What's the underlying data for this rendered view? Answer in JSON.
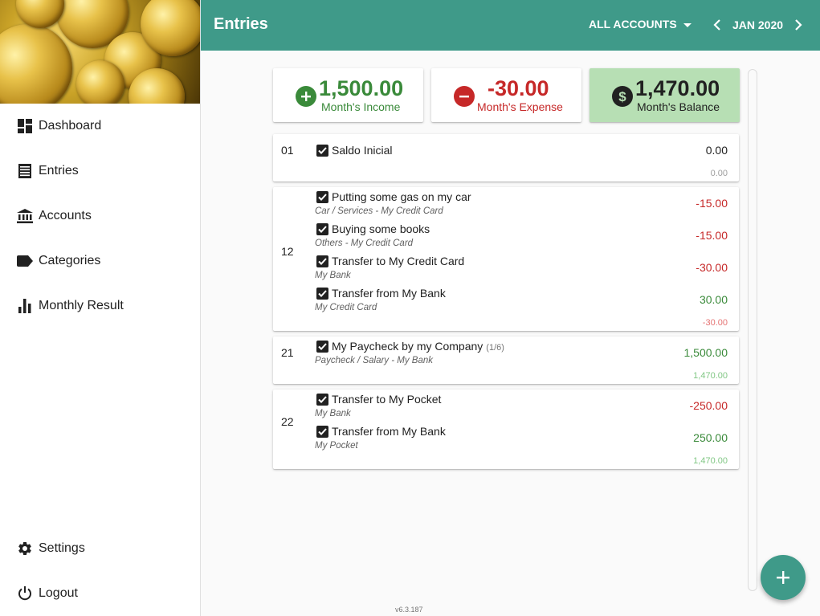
{
  "sidebar": {
    "items": [
      {
        "label": "Dashboard",
        "icon": "dashboard-icon"
      },
      {
        "label": "Entries",
        "icon": "entries-icon"
      },
      {
        "label": "Accounts",
        "icon": "bank-icon"
      },
      {
        "label": "Categories",
        "icon": "label-icon"
      },
      {
        "label": "Monthly Result",
        "icon": "bar-chart-icon"
      }
    ],
    "settings_label": "Settings",
    "logout_label": "Logout"
  },
  "header": {
    "title": "Entries",
    "accounts_filter": "ALL ACCOUNTS",
    "month": "JAN 2020"
  },
  "summary": {
    "income": {
      "amount": "1,500.00",
      "label": "Month's Income",
      "color": "#3a8a3a"
    },
    "expense": {
      "amount": "-30.00",
      "label": "Month's Expense",
      "color": "#c62828"
    },
    "balance": {
      "amount": "1,470.00",
      "label": "Month's Balance",
      "bg": "#b7dfb4"
    }
  },
  "days": [
    {
      "day": "01",
      "entries": [
        {
          "description": "Saldo Inicial",
          "installment": "",
          "details": "",
          "amount": "0.00",
          "sign": "zero"
        }
      ],
      "balance": "0.00",
      "balance_sign": "zero"
    },
    {
      "day": "12",
      "entries": [
        {
          "description": "Putting some gas on my car",
          "installment": "",
          "details": "Car / Services - My Credit Card",
          "amount": "-15.00",
          "sign": "neg"
        },
        {
          "description": "Buying some books",
          "installment": "",
          "details": "Others - My Credit Card",
          "amount": "-15.00",
          "sign": "neg"
        },
        {
          "description": "Transfer to My Credit Card",
          "installment": "",
          "details": "My Bank",
          "amount": "-30.00",
          "sign": "neg"
        },
        {
          "description": "Transfer from My Bank",
          "installment": "",
          "details": "My Credit Card",
          "amount": "30.00",
          "sign": "pos"
        }
      ],
      "balance": "-30.00",
      "balance_sign": "neg"
    },
    {
      "day": "21",
      "entries": [
        {
          "description": "My Paycheck by my Company",
          "installment": "(1/6)",
          "details": "Paycheck / Salary - My Bank",
          "amount": "1,500.00",
          "sign": "pos"
        }
      ],
      "balance": "1,470.00",
      "balance_sign": "pos"
    },
    {
      "day": "22",
      "entries": [
        {
          "description": "Transfer to My Pocket",
          "installment": "",
          "details": "My Bank",
          "amount": "-250.00",
          "sign": "neg"
        },
        {
          "description": "Transfer from My Bank",
          "installment": "",
          "details": "My Pocket",
          "amount": "250.00",
          "sign": "pos"
        }
      ],
      "balance": "1,470.00",
      "balance_sign": "pos"
    }
  ],
  "footer": {
    "version": "v6.3.187"
  },
  "colors": {
    "primary": "#3f9a89",
    "income": "#3a8a3a",
    "expense": "#c62828"
  }
}
